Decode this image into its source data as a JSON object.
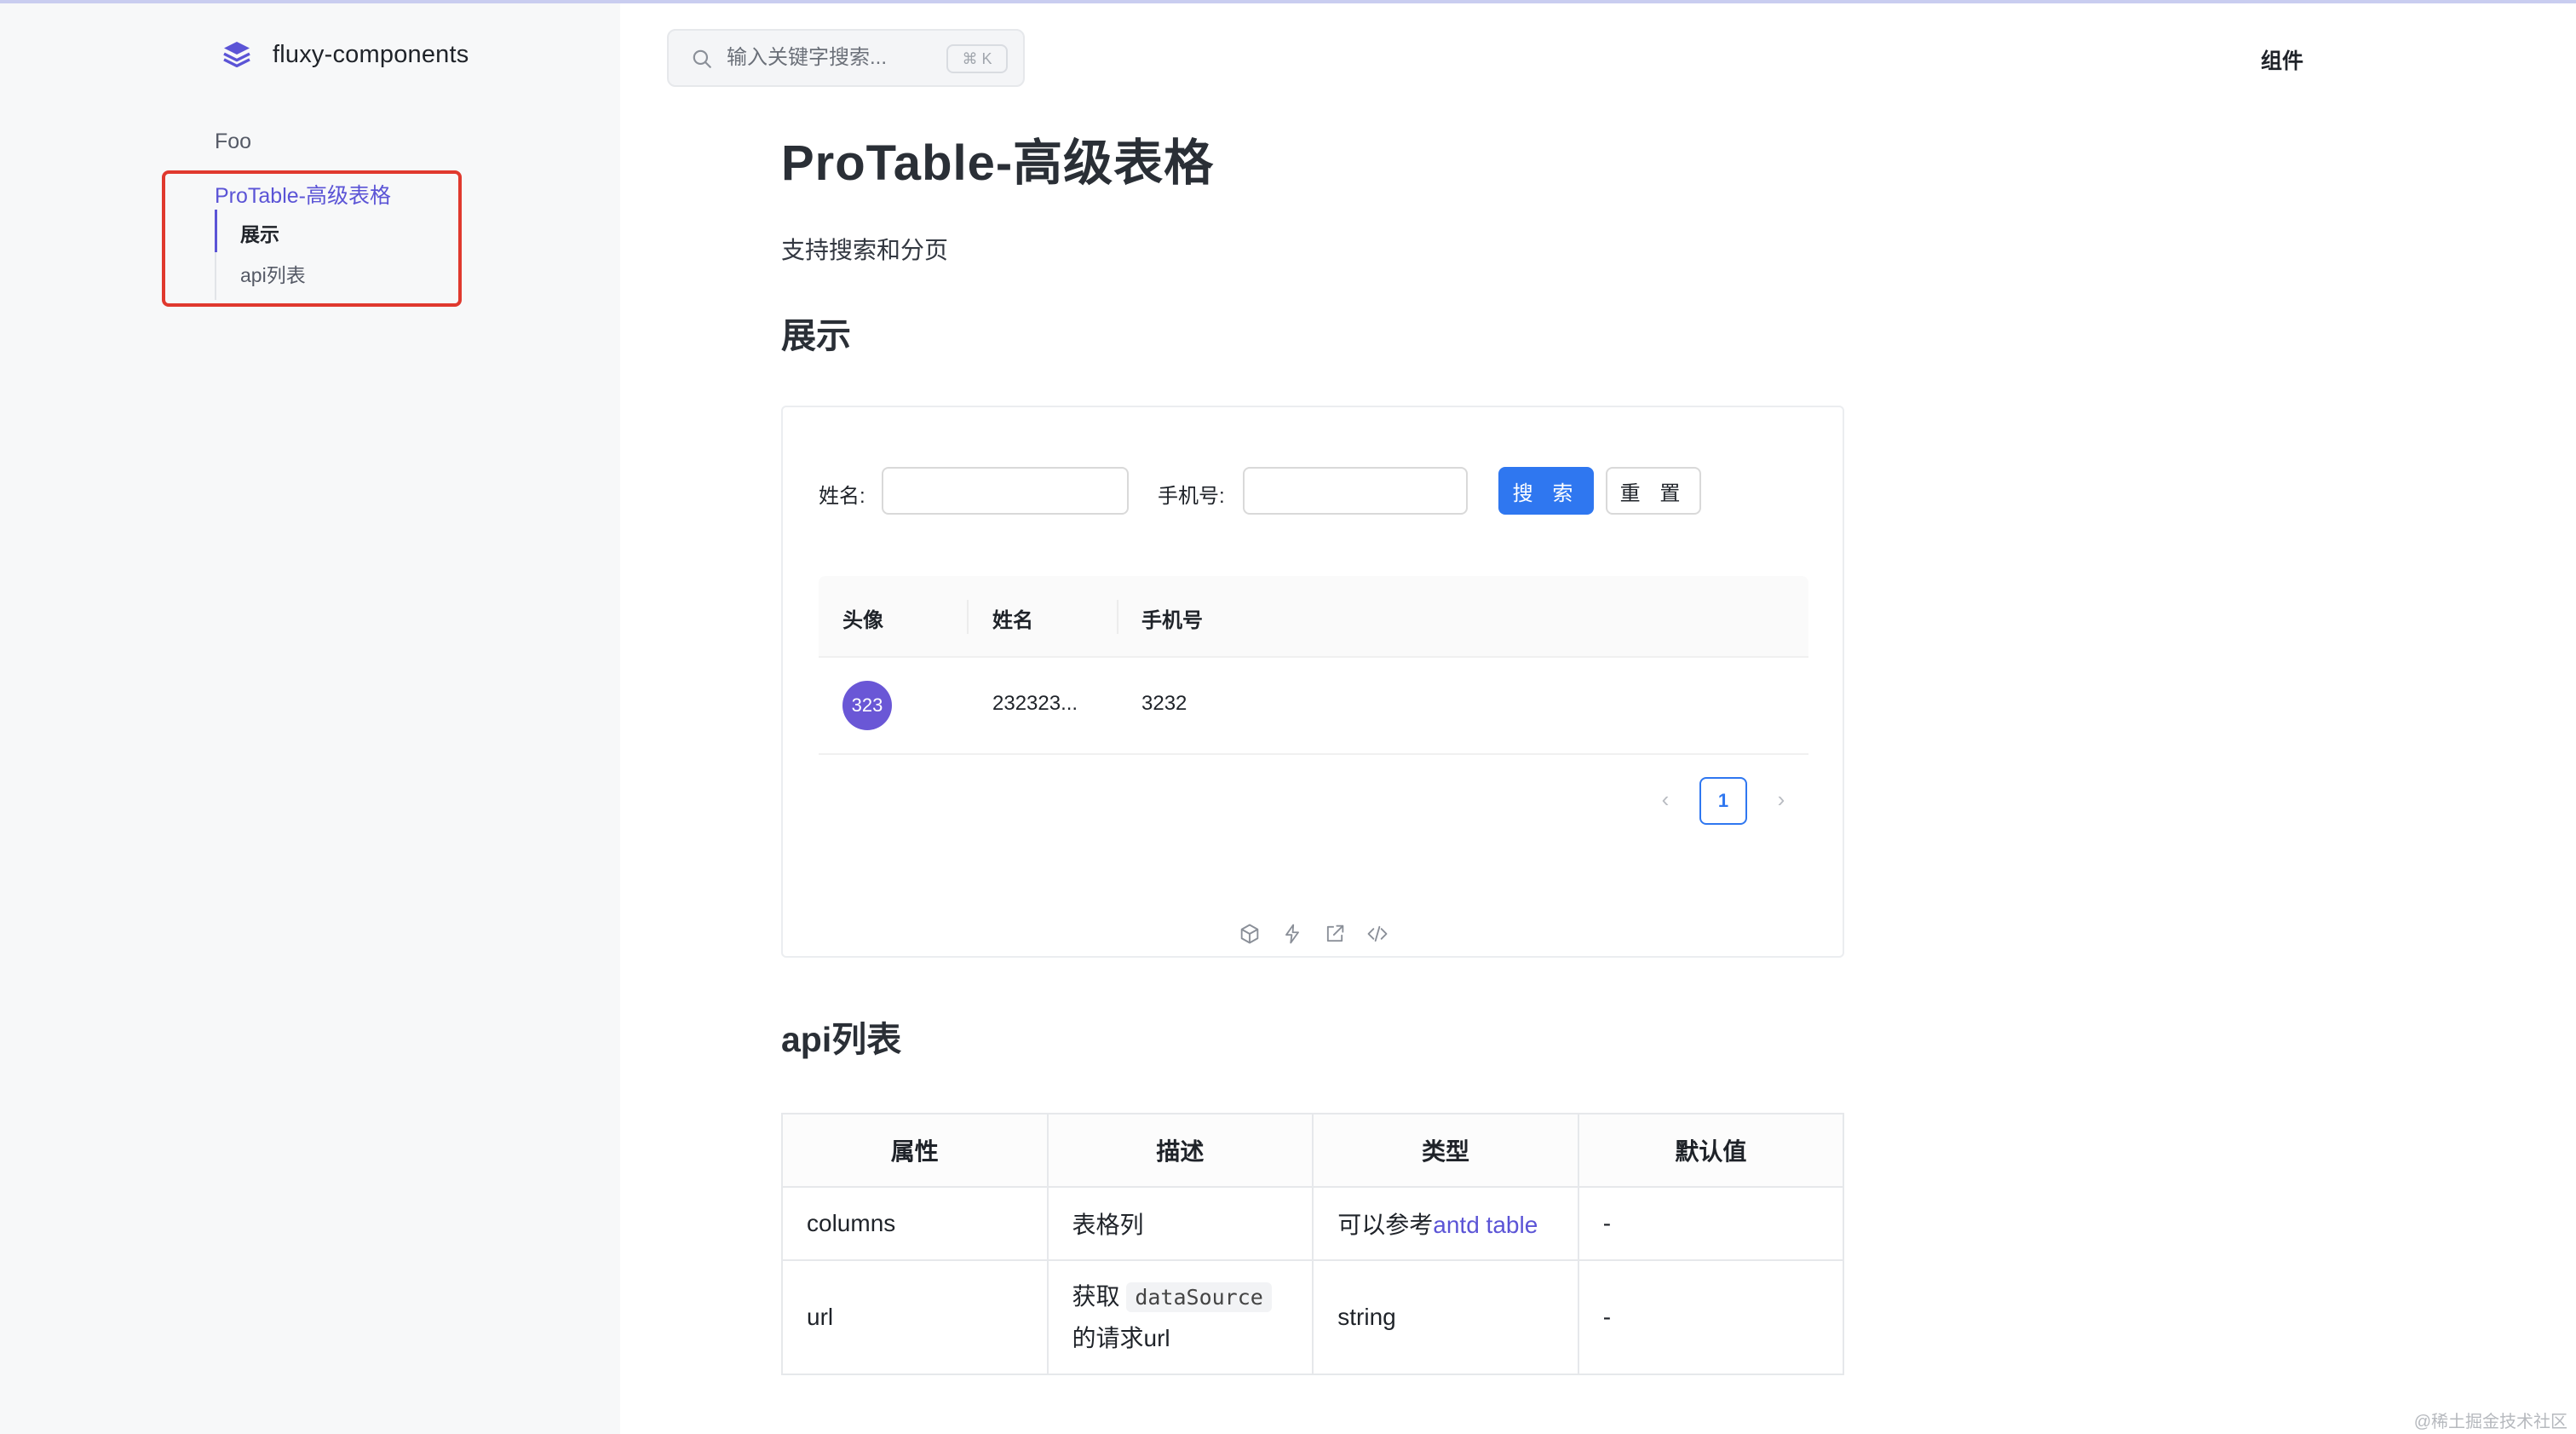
{
  "app": {
    "title": "fluxy-components"
  },
  "search": {
    "placeholder": "输入关键字搜索...",
    "shortcut": "⌘ K"
  },
  "topnav": {
    "components_label": "组件"
  },
  "sidebar": {
    "group_label": "Foo",
    "active_item": "ProTable-高级表格",
    "sub_items": [
      {
        "label": "展示"
      },
      {
        "label": "api列表"
      }
    ]
  },
  "page": {
    "title": "ProTable-高级表格",
    "description": "支持搜索和分页",
    "section_demo": "展示",
    "section_api": "api列表"
  },
  "demo": {
    "form": {
      "name_label": "姓名:",
      "phone_label": "手机号:",
      "search_button": "搜 索",
      "reset_button": "重 置",
      "name_value": "",
      "phone_value": ""
    },
    "table": {
      "columns": [
        "头像",
        "姓名",
        "手机号"
      ],
      "rows": [
        {
          "avatar": "323",
          "name": "232323...",
          "phone": "3232"
        }
      ]
    },
    "pagination": {
      "prev": "‹",
      "current_page": "1",
      "next": "›"
    },
    "action_icons": [
      "codesandbox-icon",
      "lightning-icon",
      "external-link-icon",
      "code-icon"
    ]
  },
  "api_table": {
    "headers": [
      "属性",
      "描述",
      "类型",
      "默认值"
    ],
    "rows": [
      {
        "prop": "columns",
        "desc": "表格列",
        "type_prefix": "可以参考",
        "type_link": "antd table",
        "default": "-"
      },
      {
        "prop": "url",
        "desc_prefix": "获取",
        "desc_code": "dataSource",
        "desc_suffix": "的请求url",
        "type": "string",
        "default": "-"
      }
    ]
  },
  "watermark": "@稀土掘金技术社区",
  "colors": {
    "accent": "#5b54d6",
    "primary_button": "#2f77f0",
    "highlight_border": "#e0392e",
    "avatar": "#6a57d6"
  }
}
